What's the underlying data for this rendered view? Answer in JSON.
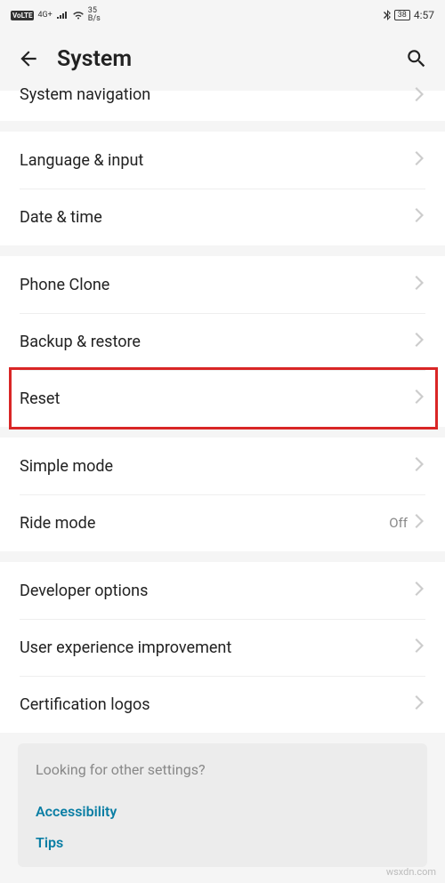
{
  "status": {
    "volte": "VoLTE",
    "network": "4G+",
    "rate_top": "35",
    "rate_bottom": "B/s",
    "battery": "38",
    "time": "4:57"
  },
  "header": {
    "title": "System"
  },
  "cutoff": {
    "label": "System navigation"
  },
  "groups": [
    {
      "rows": [
        {
          "label": "Language & input",
          "value": ""
        },
        {
          "label": "Date & time",
          "value": ""
        }
      ]
    },
    {
      "rows": [
        {
          "label": "Phone Clone",
          "value": ""
        },
        {
          "label": "Backup & restore",
          "value": ""
        },
        {
          "label": "Reset",
          "value": "",
          "highlight": true
        }
      ]
    },
    {
      "rows": [
        {
          "label": "Simple mode",
          "value": ""
        },
        {
          "label": "Ride mode",
          "value": "Off"
        }
      ]
    },
    {
      "rows": [
        {
          "label": "Developer options",
          "value": ""
        },
        {
          "label": "User experience improvement",
          "value": ""
        },
        {
          "label": "Certification logos",
          "value": ""
        }
      ]
    }
  ],
  "footer": {
    "heading": "Looking for other settings?",
    "links": [
      "Accessibility",
      "Tips"
    ]
  },
  "watermark": "wsxdn.com"
}
